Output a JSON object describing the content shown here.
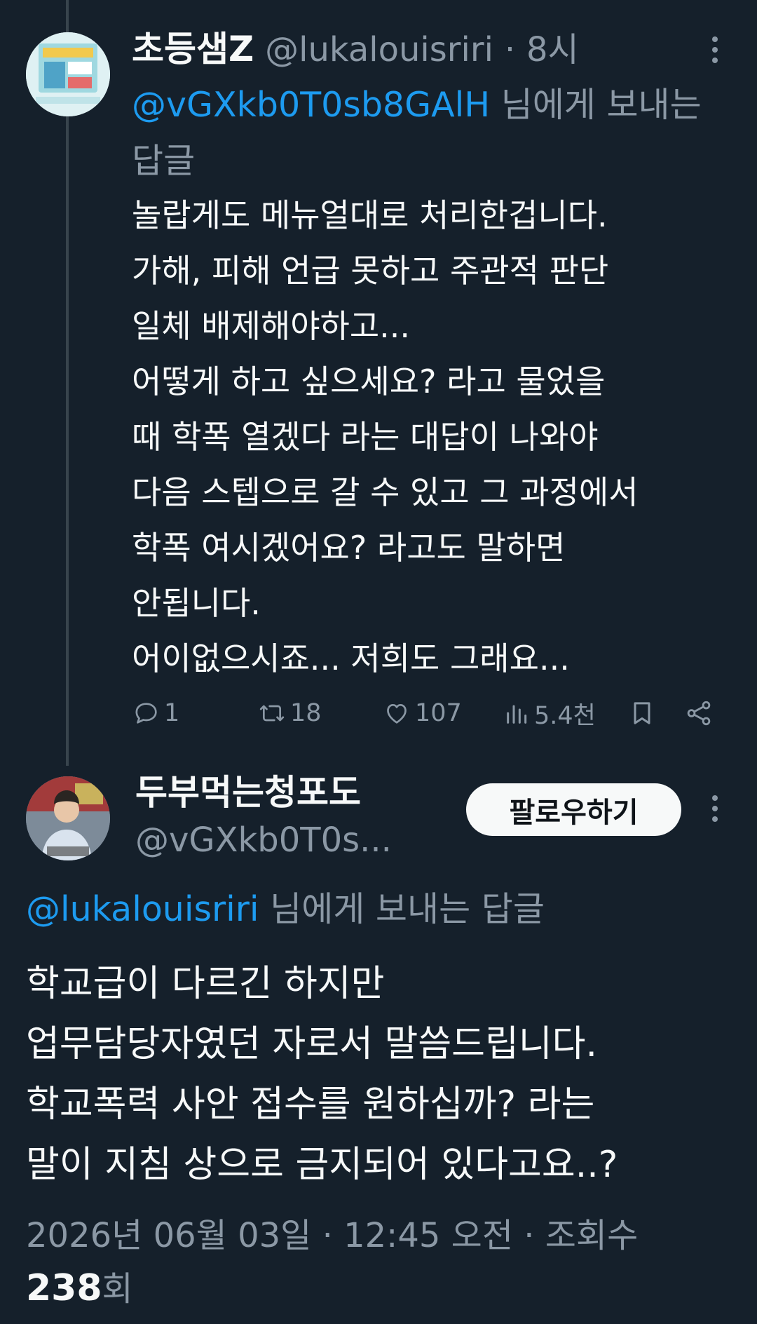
{
  "colors": {
    "background": "#15202b",
    "text": "#f7f9f9",
    "muted": "#8b98a5",
    "link": "#1d9bf0",
    "follow_button_bg": "#f7f9f9"
  },
  "tweet1": {
    "display_name": "초등샘Z",
    "handle": "@lukalouisriri",
    "separator": "·",
    "time": "8시",
    "reply_mention": "@vGXkb0T0sb8GAlH",
    "reply_suffix": "님에게 보내는 답글",
    "body_lines": [
      "놀랍게도 메뉴얼대로 처리한겁니다.",
      "가해, 피해 언급 못하고 주관적 판단",
      "일체 배제해야하고...",
      "어떻게 하고 싶으세요? 라고 물었을",
      "때 학폭 열겠다 라는 대답이 나와야",
      "다음 스텝으로 갈 수 있고 그 과정에서",
      "학폭 여시겠어요? 라고도 말하면",
      "안됩니다.",
      "어이없으시죠... 저희도 그래요..."
    ],
    "actions": {
      "reply_count": "1",
      "retweet_count": "18",
      "like_count": "107",
      "view_count": "5.4천"
    },
    "icons": [
      "reply-icon",
      "retweet-icon",
      "like-icon",
      "views-icon",
      "bookmark-icon",
      "share-icon",
      "more-icon"
    ]
  },
  "tweet2": {
    "display_name": "두부먹는청포도",
    "handle": "@vGXkb0T0s...",
    "follow_label": "팔로우하기",
    "reply_mention": "@lukalouisriri",
    "reply_suffix": "님에게 보내는 답글",
    "body_lines": [
      "학교급이 다르긴 하지만",
      "업무담당자였던 자로서 말씀드립니다.",
      "학교폭력 사안 접수를 원하십까? 라는",
      "말이 지침 상으로 금지되어 있다고요..?"
    ],
    "timestamp": "2026년 06월 03일 · 12:45 오전 · 조회수",
    "views_number": "238",
    "views_unit": "회"
  }
}
